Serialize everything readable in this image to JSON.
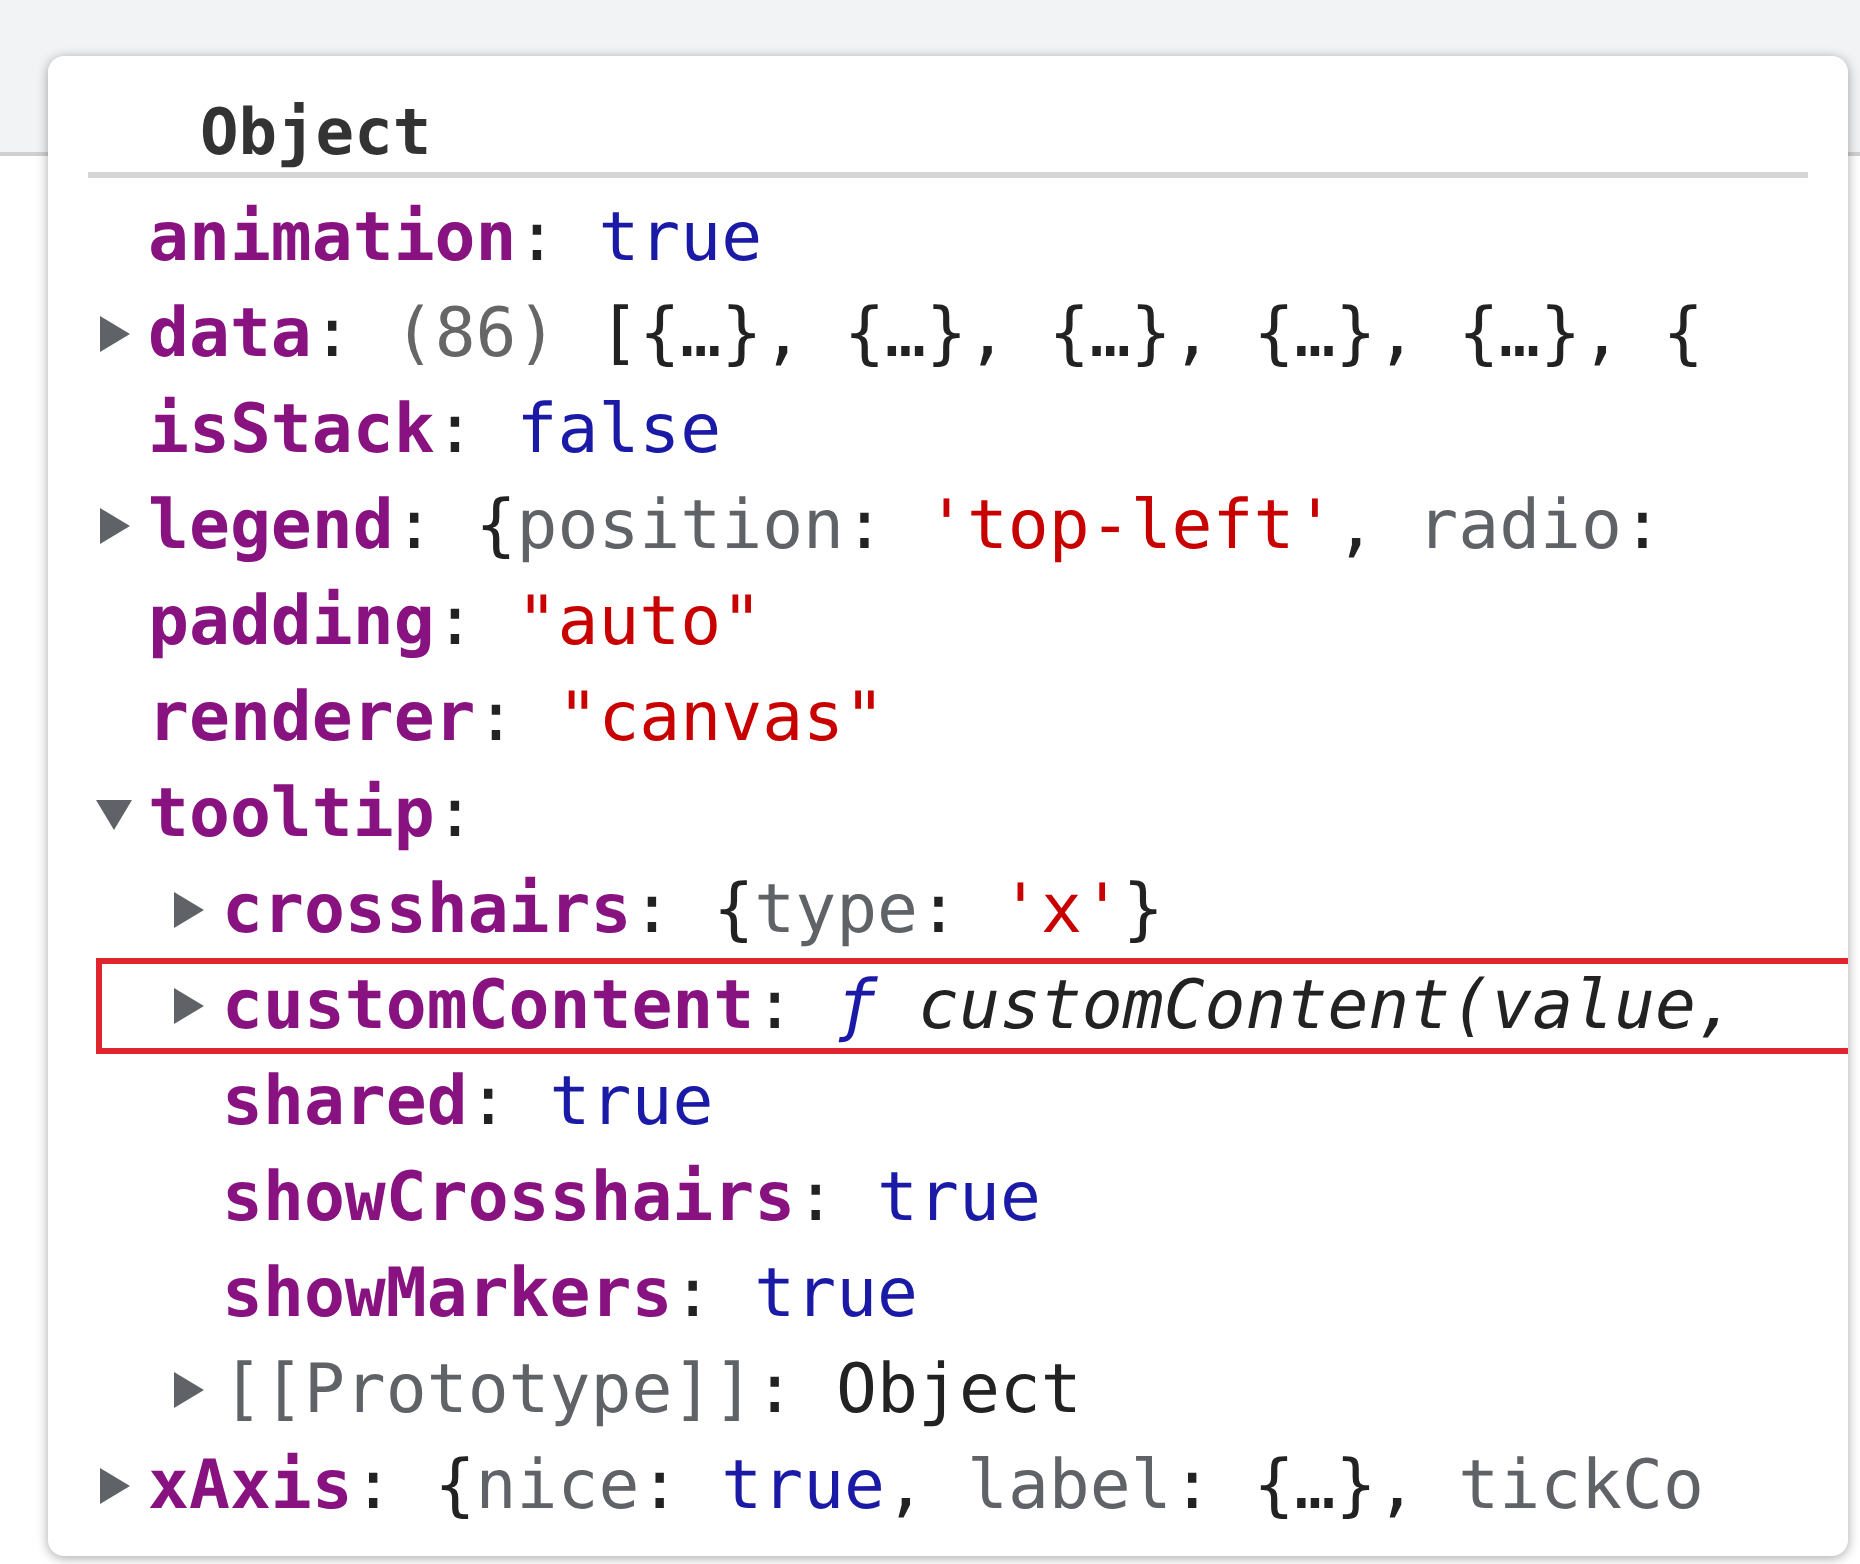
{
  "popover": {
    "title": "Object",
    "rows": [
      {
        "kind": "property",
        "key": "animation",
        "value": [
          {
            "text": ": ",
            "kind": "punct"
          },
          {
            "text": "true",
            "kind": "keyword"
          }
        ]
      },
      {
        "kind": "property",
        "key": "data",
        "expanded": false,
        "value": [
          {
            "text": ": ",
            "kind": "punct"
          },
          {
            "text": "(86)",
            "kind": "count"
          },
          {
            "text": " [{…}, {…}, {…}, {…}, {…}, {",
            "kind": "punct"
          }
        ]
      },
      {
        "kind": "property",
        "key": "isStack",
        "value": [
          {
            "text": ": ",
            "kind": "punct"
          },
          {
            "text": "false",
            "kind": "keyword"
          }
        ]
      },
      {
        "kind": "property",
        "key": "legend",
        "expanded": false,
        "value": [
          {
            "text": ": {",
            "kind": "punct"
          },
          {
            "text": "position",
            "kind": "preview"
          },
          {
            "text": ": ",
            "kind": "punct"
          },
          {
            "text": "'top-left'",
            "kind": "string"
          },
          {
            "text": ", ",
            "kind": "punct"
          },
          {
            "text": "radio",
            "kind": "preview"
          },
          {
            "text": ":",
            "kind": "punct"
          }
        ]
      },
      {
        "kind": "property",
        "key": "padding",
        "value": [
          {
            "text": ": ",
            "kind": "punct"
          },
          {
            "text": "\"auto\"",
            "kind": "string"
          }
        ]
      },
      {
        "kind": "property",
        "key": "renderer",
        "value": [
          {
            "text": ": ",
            "kind": "punct"
          },
          {
            "text": "\"canvas\"",
            "kind": "string"
          }
        ]
      },
      {
        "kind": "property",
        "key": "tooltip",
        "expanded": true,
        "value": [
          {
            "text": ":",
            "kind": "punct"
          }
        ],
        "children": [
          {
            "kind": "property",
            "key": "crosshairs",
            "expanded": false,
            "value": [
              {
                "text": ": {",
                "kind": "punct"
              },
              {
                "text": "type",
                "kind": "preview"
              },
              {
                "text": ": ",
                "kind": "punct"
              },
              {
                "text": "'x'",
                "kind": "string"
              },
              {
                "text": "}",
                "kind": "punct"
              }
            ]
          },
          {
            "kind": "property",
            "key": "customContent",
            "expanded": false,
            "highlighted": true,
            "value": [
              {
                "text": ": ",
                "kind": "punct"
              },
              {
                "text": "ƒ",
                "kind": "func-mark"
              },
              {
                "text": " customContent(value,",
                "kind": "func"
              }
            ]
          },
          {
            "kind": "property",
            "key": "shared",
            "value": [
              {
                "text": ": ",
                "kind": "punct"
              },
              {
                "text": "true",
                "kind": "keyword"
              }
            ]
          },
          {
            "kind": "property",
            "key": "showCrosshairs",
            "value": [
              {
                "text": ": ",
                "kind": "punct"
              },
              {
                "text": "true",
                "kind": "keyword"
              }
            ]
          },
          {
            "kind": "property",
            "key": "showMarkers",
            "value": [
              {
                "text": ": ",
                "kind": "punct"
              },
              {
                "text": "true",
                "kind": "keyword"
              }
            ]
          },
          {
            "kind": "internal",
            "key": "[[Prototype]]",
            "expanded": false,
            "value": [
              {
                "text": ": Object",
                "kind": "punct"
              }
            ]
          }
        ]
      },
      {
        "kind": "property",
        "key": "xAxis",
        "expanded": false,
        "value": [
          {
            "text": ": {",
            "kind": "punct"
          },
          {
            "text": "nice",
            "kind": "preview"
          },
          {
            "text": ": ",
            "kind": "punct"
          },
          {
            "text": "true",
            "kind": "keyword"
          },
          {
            "text": ", ",
            "kind": "punct"
          },
          {
            "text": "label",
            "kind": "preview"
          },
          {
            "text": ": {…}, ",
            "kind": "punct"
          },
          {
            "text": "tickCo",
            "kind": "preview"
          }
        ]
      }
    ]
  }
}
